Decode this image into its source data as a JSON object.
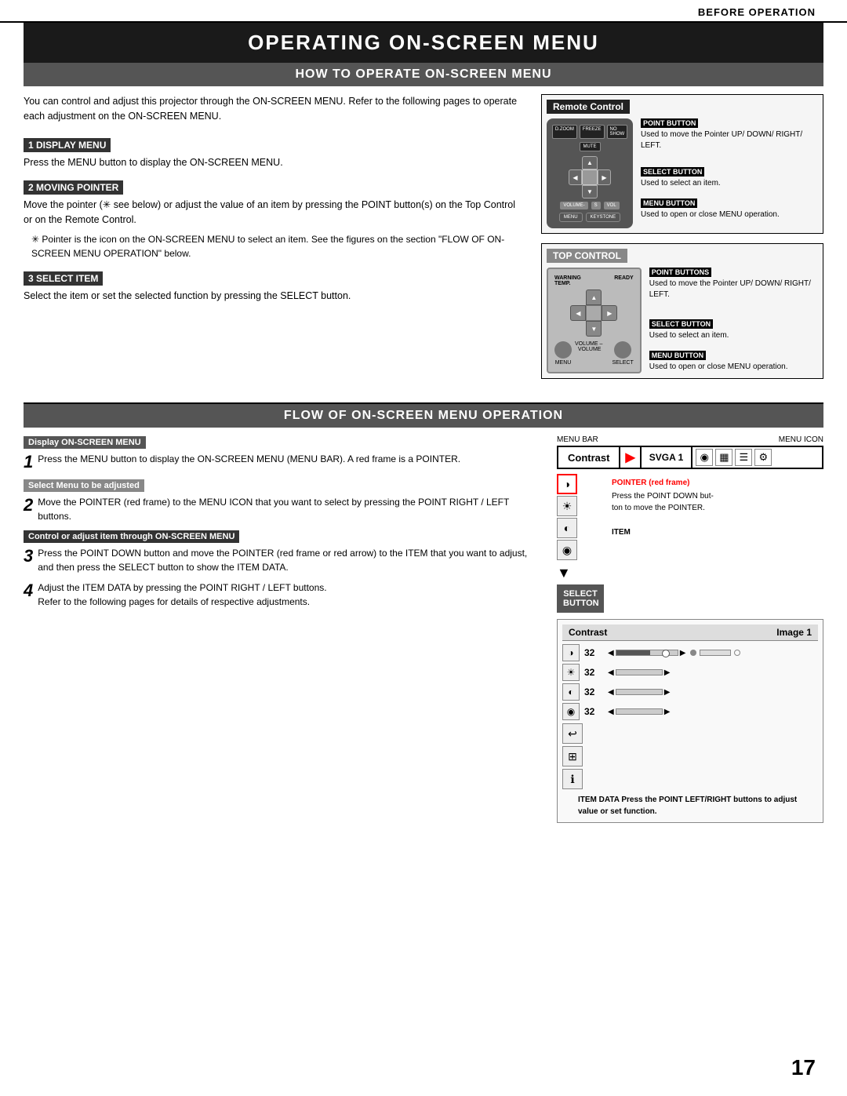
{
  "header": {
    "before_operation": "BEFORE OPERATION"
  },
  "main_title": "OPERATING ON-SCREEN MENU",
  "section1": {
    "title": "HOW TO OPERATE ON-SCREEN MENU",
    "intro": "You can control and adjust this projector through the ON-SCREEN MENU.  Refer to the following pages to operate each adjustment on the ON-SCREEN MENU.",
    "steps": [
      {
        "id": "1",
        "header": "1  DISPLAY MENU",
        "text": "Press the MENU button to display the ON-SCREEN MENU."
      },
      {
        "id": "2",
        "header": "2  MOVING POINTER",
        "text": "Move the pointer (✳ see below) or adjust the value of an item by pressing the POINT button(s) on the Top Control or on the Remote Control."
      },
      {
        "id": "note",
        "text": "✳  Pointer is the icon on the ON-SCREEN MENU to select an item. See the figures on the section \"FLOW OF ON-SCREEN MENU OPERATION\" below."
      },
      {
        "id": "3",
        "header": "3  SELECT ITEM",
        "text": "Select the item or set the selected function by pressing the SELECT button."
      }
    ],
    "remote_control": {
      "title": "Remote Control",
      "buttons": [
        "D.ZOOM",
        "FREEZE",
        "NO SHOW",
        "MUTE",
        "VOLUME-",
        "S",
        "VOL",
        "MENU",
        "KEYSTONE"
      ],
      "annotations": {
        "point_button": {
          "label": "POINT BUTTON",
          "text": "Used to move the Pointer UP/ DOWN/ RIGHT/ LEFT."
        },
        "select_button": {
          "label": "SELECT BUTTON",
          "text": "Used to select an item."
        },
        "menu_button": {
          "label": "MENU BUTTON",
          "text": "Used to open or close MENU operation."
        }
      }
    },
    "top_control": {
      "title": "TOP CONTROL",
      "labels": [
        "WARNING TEMP.",
        "READY",
        "VOLUME –",
        "VOLUME",
        "MENU",
        "SELECT"
      ],
      "annotations": {
        "point_buttons": {
          "label": "POINT BUTTONS",
          "text": "Used to move the Pointer UP/ DOWN/ RIGHT/ LEFT."
        },
        "select_button": {
          "label": "SELECT BUTTON",
          "text": "Used to select an item."
        },
        "menu_button": {
          "label": "MENU BUTTON",
          "text": "Used to open or close MENU operation."
        }
      }
    }
  },
  "section2": {
    "title": "FLOW OF ON-SCREEN MENU OPERATION",
    "steps": [
      {
        "num": "1",
        "header": "Display ON-SCREEN MENU",
        "header_style": "dark",
        "text": "Press the MENU button to display the ON-SCREEN MENU (MENU BAR).  A red frame is a POINTER."
      },
      {
        "num": "2",
        "header": "Select Menu to be adjusted",
        "header_style": "light",
        "text": "Move the POINTER (red frame) to the MENU ICON that you want to select by pressing the POINT RIGHT / LEFT buttons."
      },
      {
        "num": "3",
        "header": "Control or adjust item through ON-SCREEN MENU",
        "header_style": "medium",
        "text": "Press the POINT DOWN button and move the POINTER (red frame or red arrow) to the ITEM that you want to adjust, and then press the SELECT button to show the ITEM DATA."
      },
      {
        "num": "4",
        "header": "",
        "text": "Adjust the ITEM DATA by pressing the POINT RIGHT / LEFT buttons.\nRefer to the following pages for details of respective adjustments."
      }
    ],
    "menu_bar_diagram": {
      "labels": {
        "menu_bar": "MENU BAR",
        "menu_icon": "MENU ICON",
        "pointer": "POINTER",
        "red_frame": "(red frame)"
      },
      "bar": {
        "contrast": "Contrast",
        "pointer_symbol": "▶",
        "svga": "SVGA 1"
      },
      "pointer_note": "POINTER (red frame)\nPress the POINT DOWN button to move the POINTER.",
      "item_label": "ITEM",
      "select_button": {
        "line1": "SELECT",
        "line2": "BUTTON"
      }
    },
    "data_diagram": {
      "header": {
        "left": "Contrast",
        "right": "Image 1"
      },
      "items": [
        {
          "icon": "◑",
          "value": "32"
        },
        {
          "icon": "☀",
          "value": "32"
        },
        {
          "icon": "◑",
          "value": "32"
        },
        {
          "icon": "◉",
          "value": "32"
        }
      ],
      "item_data_note": "ITEM DATA\nPress the POINT LEFT/RIGHT buttons to adjust value or set function."
    }
  },
  "page_number": "17"
}
